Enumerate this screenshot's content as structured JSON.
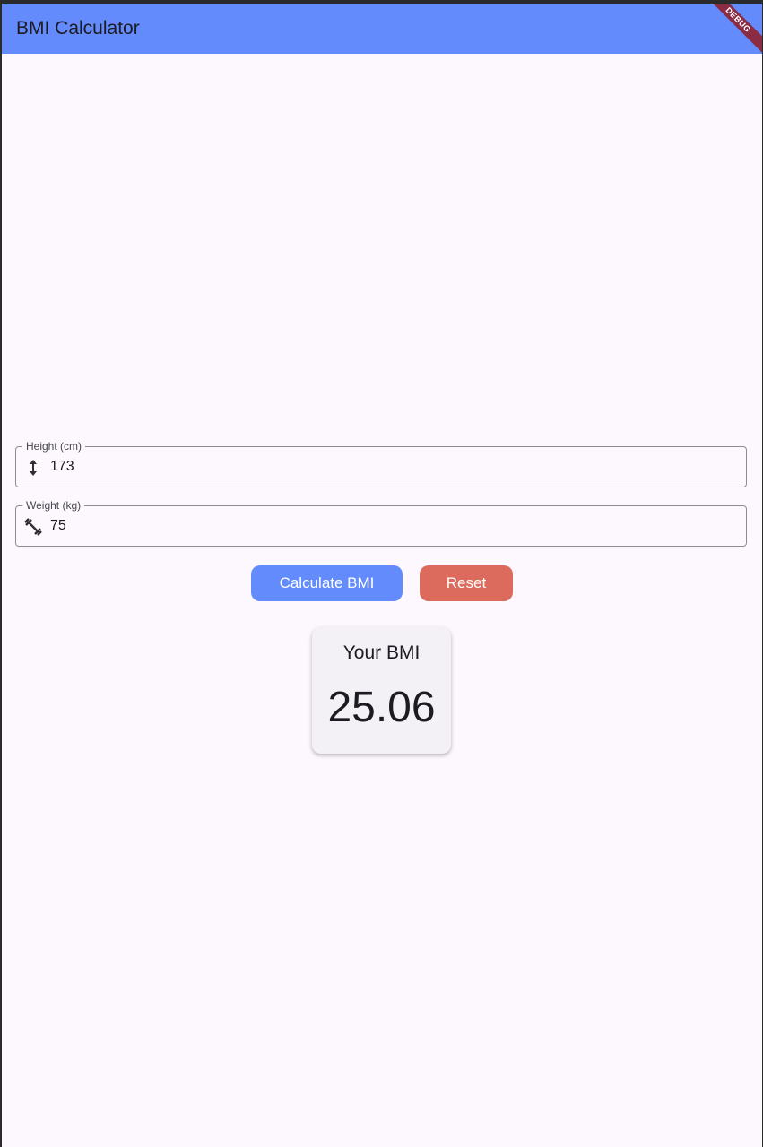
{
  "appbar": {
    "title": "BMI Calculator",
    "debug_banner": "DEBUG"
  },
  "form": {
    "height": {
      "label": "Height (cm)",
      "value": "173",
      "icon": "height-icon"
    },
    "weight": {
      "label": "Weight (kg)",
      "value": "75",
      "icon": "dumbbell-icon"
    }
  },
  "actions": {
    "calculate_label": "Calculate BMI",
    "reset_label": "Reset"
  },
  "result": {
    "label": "Your BMI",
    "value": "25.06"
  },
  "colors": {
    "primary": "#638bfc",
    "reset": "#dc6a5d",
    "background": "#fcf8fd"
  }
}
